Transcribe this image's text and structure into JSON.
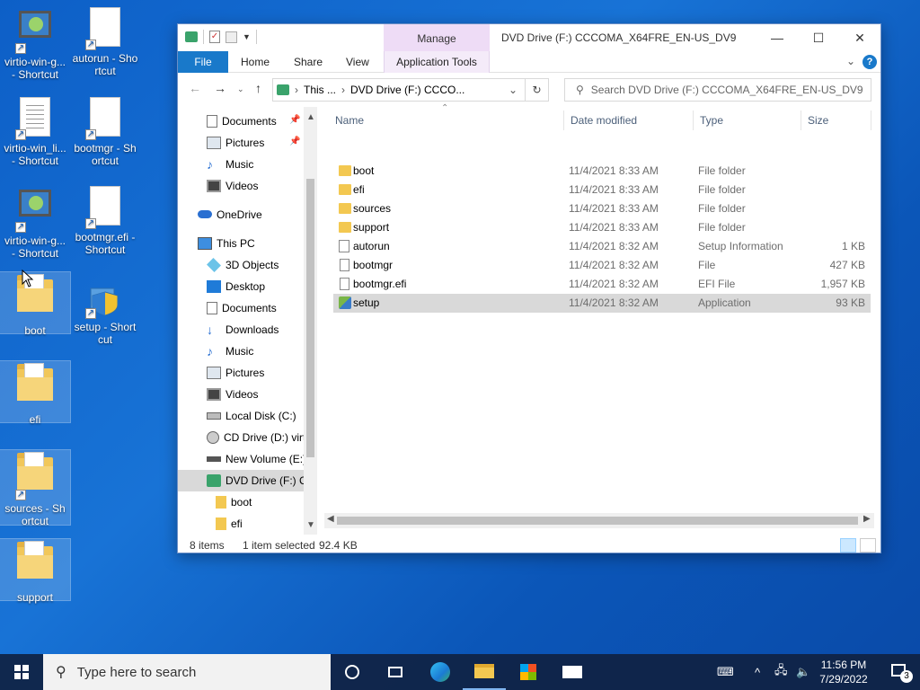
{
  "desktop": {
    "icons": [
      {
        "label": "virtio-win-g... - Shortcut"
      },
      {
        "label": "autorun - Shortcut"
      },
      {
        "label": "virtio-win_li... - Shortcut"
      },
      {
        "label": "bootmgr - Shortcut"
      },
      {
        "label": "virtio-win-g... - Shortcut"
      },
      {
        "label": "bootmgr.efi - Shortcut"
      },
      {
        "label": "boot"
      },
      {
        "label": "setup - Shortcut"
      },
      {
        "label": "efi"
      },
      {
        "label": "sources - Shortcut"
      },
      {
        "label": "support"
      }
    ]
  },
  "window": {
    "title": "DVD Drive (F:) CCCOMA_X64FRE_EN-US_DV9",
    "manage_label": "Manage",
    "ribbon_tabs": [
      "File",
      "Home",
      "Share",
      "View",
      "Application Tools"
    ],
    "address": {
      "prefix": "This ...",
      "path": "DVD Drive (F:) CCCO..."
    },
    "search_placeholder": "Search DVD Drive (F:) CCCOMA_X64FRE_EN-US_DV9",
    "nav_items": [
      {
        "label": "Documents",
        "pinned": true
      },
      {
        "label": "Pictures",
        "pinned": true
      },
      {
        "label": "Music"
      },
      {
        "label": "Videos"
      },
      {
        "label": "OneDrive"
      },
      {
        "label": "This PC"
      },
      {
        "label": "3D Objects"
      },
      {
        "label": "Desktop"
      },
      {
        "label": "Documents"
      },
      {
        "label": "Downloads"
      },
      {
        "label": "Music"
      },
      {
        "label": "Pictures"
      },
      {
        "label": "Videos"
      },
      {
        "label": "Local Disk (C:)"
      },
      {
        "label": "CD Drive (D:) virt"
      },
      {
        "label": "New Volume (E:)"
      },
      {
        "label": "DVD Drive (F:) C("
      },
      {
        "label": "boot"
      },
      {
        "label": "efi"
      }
    ],
    "columns": {
      "name": "Name",
      "date": "Date modified",
      "type": "Type",
      "size": "Size"
    },
    "files": [
      {
        "name": "boot",
        "date": "11/4/2021 8:33 AM",
        "type": "File folder",
        "size": "",
        "icon": "folder"
      },
      {
        "name": "efi",
        "date": "11/4/2021 8:33 AM",
        "type": "File folder",
        "size": "",
        "icon": "folder"
      },
      {
        "name": "sources",
        "date": "11/4/2021 8:33 AM",
        "type": "File folder",
        "size": "",
        "icon": "folder"
      },
      {
        "name": "support",
        "date": "11/4/2021 8:33 AM",
        "type": "File folder",
        "size": "",
        "icon": "folder"
      },
      {
        "name": "autorun",
        "date": "11/4/2021 8:32 AM",
        "type": "Setup Information",
        "size": "1 KB",
        "icon": "inf"
      },
      {
        "name": "bootmgr",
        "date": "11/4/2021 8:32 AM",
        "type": "File",
        "size": "427 KB",
        "icon": "file"
      },
      {
        "name": "bootmgr.efi",
        "date": "11/4/2021 8:32 AM",
        "type": "EFI File",
        "size": "1,957 KB",
        "icon": "file"
      },
      {
        "name": "setup",
        "date": "11/4/2021 8:32 AM",
        "type": "Application",
        "size": "93 KB",
        "icon": "app"
      }
    ],
    "status": {
      "count": "8 items",
      "selected": "1 item selected",
      "size": "92.4 KB"
    }
  },
  "taskbar": {
    "search_placeholder": "Type here to search",
    "time": "11:56 PM",
    "date": "7/29/2022",
    "notification_count": "3"
  },
  "colors": {
    "accent": "#1979ca",
    "manage_tab": "#eedcf6",
    "selection": "#d9d9d9"
  }
}
